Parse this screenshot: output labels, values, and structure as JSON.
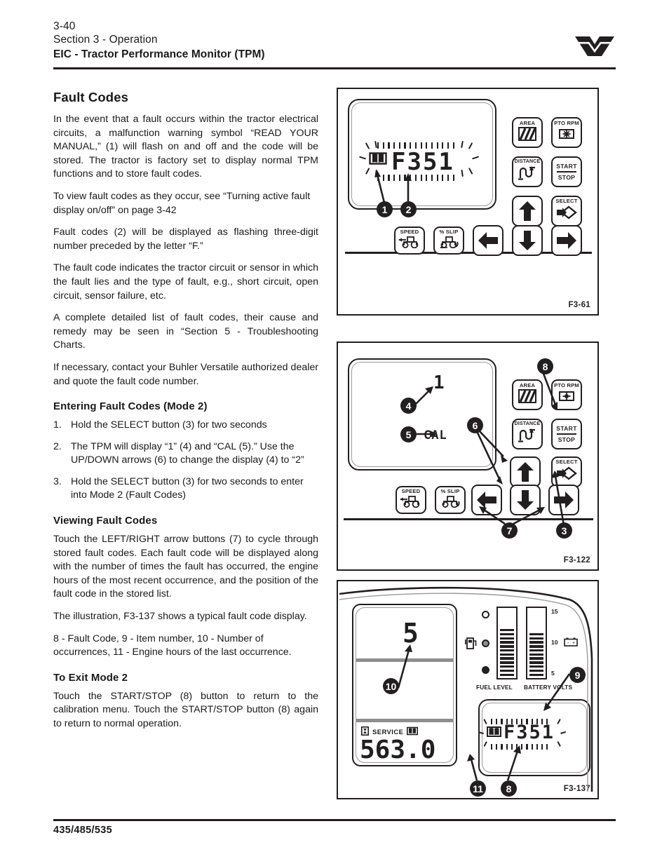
{
  "header": {
    "page_number": "3-40",
    "section": "Section 3 - Operation",
    "title": "EIC - Tractor Performance Monitor (TPM)",
    "logo_name": "versatile-logo"
  },
  "footer": {
    "models": "435/485/535"
  },
  "content": {
    "heading": "Fault Codes",
    "p1": "In the event that a fault occurs within the tractor electrical circuits, a malfunction warning symbol “READ YOUR MANUAL,” (1) will flash on and off and the code will be stored. The tractor is factory set to display normal TPM functions and to store fault codes.",
    "p2": "To view fault codes as they occur, see “Turning active fault display on/off” on page 3-42",
    "p3": "Fault codes (2) will be displayed as flashing three-digit number preceded by the letter “F.”",
    "p4": "The fault code indicates the tractor circuit or sensor in which the fault lies and the type of fault, e.g., short circuit, open circuit, sensor failure, etc.",
    "p5": "A complete detailed list of fault codes, their cause and remedy may be seen in “Section 5 - Troubleshooting Charts.",
    "p6": "If necessary, contact your Buhler Versatile authorized dealer and quote the fault code number.",
    "entering_heading": "Entering Fault Codes (Mode 2)",
    "steps": [
      "Hold the SELECT button (3) for two seconds",
      "The TPM will display “1” (4)  and “CAL  (5).” Use the UP/DOWN arrows (6) to change the display (4) to “2”",
      "Hold the SELECT button (3) for two seconds to enter into Mode 2 (Fault Codes)"
    ],
    "viewing_heading": "Viewing Fault Codes",
    "p7": "Touch the LEFT/RIGHT arrow buttons (7) to cycle through stored fault codes. Each fault code will be displayed along with the number of times the fault has occurred, the engine hours of the most recent occurrence, and the position of the fault code in the stored list.",
    "p8": "The illustration, F3-137 shows a typical fault code display.",
    "p9": "8 - Fault Code, 9 - Item number, 10 - Number of occurrences, 11 - Engine hours of the last occurrence.",
    "exit_heading": "To Exit Mode 2",
    "p10": "Touch the START/STOP (8) button to return to the calibration menu. Touch the START/STOP button (8) again to return to normal operation."
  },
  "figures": {
    "fig1": {
      "label": "F3-61",
      "display_value": "F351",
      "callouts": [
        "1",
        "2"
      ],
      "buttons": [
        {
          "name": "area",
          "cap": "AREA"
        },
        {
          "name": "pto-rpm",
          "cap": "PTO RPM"
        },
        {
          "name": "distance",
          "cap": "DISTANCE"
        },
        {
          "name": "start-stop",
          "cap_top": "START",
          "cap_bottom": "STOP"
        },
        {
          "name": "up-arrow",
          "cap": ""
        },
        {
          "name": "select",
          "cap": "SELECT"
        },
        {
          "name": "speed",
          "cap": "SPEED"
        },
        {
          "name": "percent-slip",
          "cap": "% SLIP"
        },
        {
          "name": "left-arrow",
          "cap": ""
        },
        {
          "name": "down-arrow",
          "cap": ""
        },
        {
          "name": "right-arrow",
          "cap": ""
        }
      ]
    },
    "fig2": {
      "label": "F3-122",
      "display_value": "1",
      "cal_text": "CAL",
      "callouts": [
        "3",
        "4",
        "5",
        "6",
        "7",
        "8"
      ]
    },
    "fig3": {
      "label": "F3-137",
      "item_number": "5",
      "service_label": "SERVICE",
      "engine_hours": "563.0",
      "fault_code": "F351",
      "fuel_gauge_label": "FUEL LEVEL",
      "battery_gauge_label": "BATTERY VOLTS",
      "battery_ticks": [
        "15",
        "10",
        "5"
      ],
      "callouts": [
        "8",
        "9",
        "10",
        "11"
      ]
    }
  },
  "colors": {
    "ink": "#231f20",
    "paper": "#ffffff",
    "rule_gray": "#9a9a9a"
  }
}
